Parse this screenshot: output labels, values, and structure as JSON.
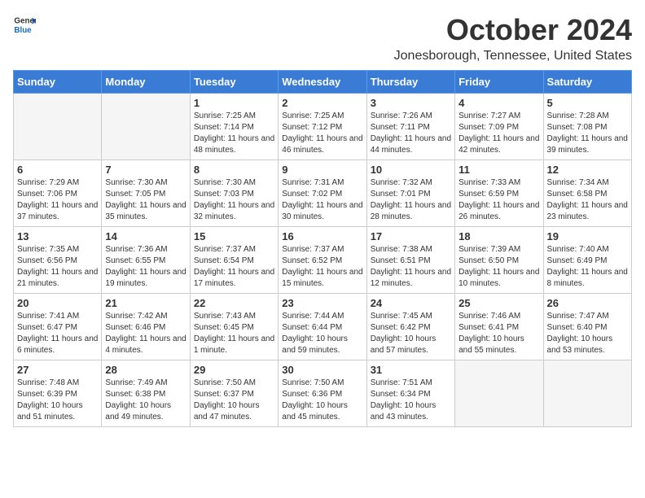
{
  "header": {
    "logo_line1": "General",
    "logo_line2": "Blue",
    "month": "October 2024",
    "location": "Jonesborough, Tennessee, United States"
  },
  "columns": [
    "Sunday",
    "Monday",
    "Tuesday",
    "Wednesday",
    "Thursday",
    "Friday",
    "Saturday"
  ],
  "weeks": [
    [
      {
        "day": "",
        "detail": ""
      },
      {
        "day": "",
        "detail": ""
      },
      {
        "day": "1",
        "detail": "Sunrise: 7:25 AM\nSunset: 7:14 PM\nDaylight: 11 hours and 48 minutes."
      },
      {
        "day": "2",
        "detail": "Sunrise: 7:25 AM\nSunset: 7:12 PM\nDaylight: 11 hours and 46 minutes."
      },
      {
        "day": "3",
        "detail": "Sunrise: 7:26 AM\nSunset: 7:11 PM\nDaylight: 11 hours and 44 minutes."
      },
      {
        "day": "4",
        "detail": "Sunrise: 7:27 AM\nSunset: 7:09 PM\nDaylight: 11 hours and 42 minutes."
      },
      {
        "day": "5",
        "detail": "Sunrise: 7:28 AM\nSunset: 7:08 PM\nDaylight: 11 hours and 39 minutes."
      }
    ],
    [
      {
        "day": "6",
        "detail": "Sunrise: 7:29 AM\nSunset: 7:06 PM\nDaylight: 11 hours and 37 minutes."
      },
      {
        "day": "7",
        "detail": "Sunrise: 7:30 AM\nSunset: 7:05 PM\nDaylight: 11 hours and 35 minutes."
      },
      {
        "day": "8",
        "detail": "Sunrise: 7:30 AM\nSunset: 7:03 PM\nDaylight: 11 hours and 32 minutes."
      },
      {
        "day": "9",
        "detail": "Sunrise: 7:31 AM\nSunset: 7:02 PM\nDaylight: 11 hours and 30 minutes."
      },
      {
        "day": "10",
        "detail": "Sunrise: 7:32 AM\nSunset: 7:01 PM\nDaylight: 11 hours and 28 minutes."
      },
      {
        "day": "11",
        "detail": "Sunrise: 7:33 AM\nSunset: 6:59 PM\nDaylight: 11 hours and 26 minutes."
      },
      {
        "day": "12",
        "detail": "Sunrise: 7:34 AM\nSunset: 6:58 PM\nDaylight: 11 hours and 23 minutes."
      }
    ],
    [
      {
        "day": "13",
        "detail": "Sunrise: 7:35 AM\nSunset: 6:56 PM\nDaylight: 11 hours and 21 minutes."
      },
      {
        "day": "14",
        "detail": "Sunrise: 7:36 AM\nSunset: 6:55 PM\nDaylight: 11 hours and 19 minutes."
      },
      {
        "day": "15",
        "detail": "Sunrise: 7:37 AM\nSunset: 6:54 PM\nDaylight: 11 hours and 17 minutes."
      },
      {
        "day": "16",
        "detail": "Sunrise: 7:37 AM\nSunset: 6:52 PM\nDaylight: 11 hours and 15 minutes."
      },
      {
        "day": "17",
        "detail": "Sunrise: 7:38 AM\nSunset: 6:51 PM\nDaylight: 11 hours and 12 minutes."
      },
      {
        "day": "18",
        "detail": "Sunrise: 7:39 AM\nSunset: 6:50 PM\nDaylight: 11 hours and 10 minutes."
      },
      {
        "day": "19",
        "detail": "Sunrise: 7:40 AM\nSunset: 6:49 PM\nDaylight: 11 hours and 8 minutes."
      }
    ],
    [
      {
        "day": "20",
        "detail": "Sunrise: 7:41 AM\nSunset: 6:47 PM\nDaylight: 11 hours and 6 minutes."
      },
      {
        "day": "21",
        "detail": "Sunrise: 7:42 AM\nSunset: 6:46 PM\nDaylight: 11 hours and 4 minutes."
      },
      {
        "day": "22",
        "detail": "Sunrise: 7:43 AM\nSunset: 6:45 PM\nDaylight: 11 hours and 1 minute."
      },
      {
        "day": "23",
        "detail": "Sunrise: 7:44 AM\nSunset: 6:44 PM\nDaylight: 10 hours and 59 minutes."
      },
      {
        "day": "24",
        "detail": "Sunrise: 7:45 AM\nSunset: 6:42 PM\nDaylight: 10 hours and 57 minutes."
      },
      {
        "day": "25",
        "detail": "Sunrise: 7:46 AM\nSunset: 6:41 PM\nDaylight: 10 hours and 55 minutes."
      },
      {
        "day": "26",
        "detail": "Sunrise: 7:47 AM\nSunset: 6:40 PM\nDaylight: 10 hours and 53 minutes."
      }
    ],
    [
      {
        "day": "27",
        "detail": "Sunrise: 7:48 AM\nSunset: 6:39 PM\nDaylight: 10 hours and 51 minutes."
      },
      {
        "day": "28",
        "detail": "Sunrise: 7:49 AM\nSunset: 6:38 PM\nDaylight: 10 hours and 49 minutes."
      },
      {
        "day": "29",
        "detail": "Sunrise: 7:50 AM\nSunset: 6:37 PM\nDaylight: 10 hours and 47 minutes."
      },
      {
        "day": "30",
        "detail": "Sunrise: 7:50 AM\nSunset: 6:36 PM\nDaylight: 10 hours and 45 minutes."
      },
      {
        "day": "31",
        "detail": "Sunrise: 7:51 AM\nSunset: 6:34 PM\nDaylight: 10 hours and 43 minutes."
      },
      {
        "day": "",
        "detail": ""
      },
      {
        "day": "",
        "detail": ""
      }
    ]
  ]
}
